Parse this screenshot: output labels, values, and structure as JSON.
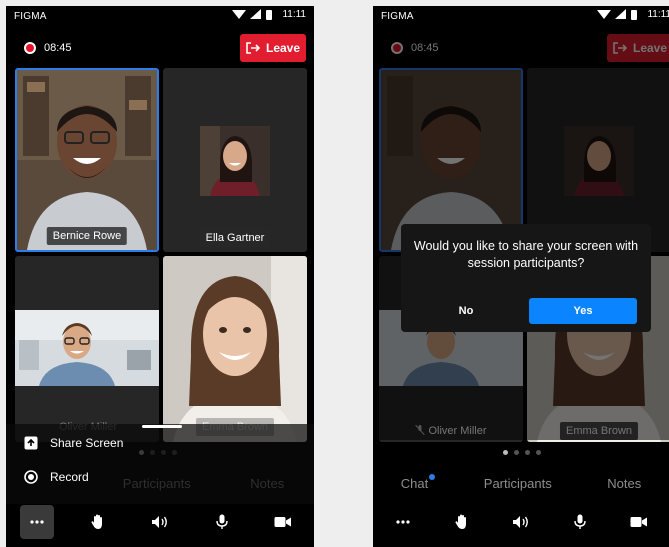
{
  "status_bar": {
    "carrier": "FIGMA",
    "time": "11:11"
  },
  "recording": {
    "timer": "08:45"
  },
  "header": {
    "leave_label": "Leave"
  },
  "participants": [
    {
      "name": "Bernice Rowe",
      "active": true
    },
    {
      "name": "Ella Gartner",
      "active": false
    },
    {
      "name": "Oliver Miller",
      "active": false
    },
    {
      "name": "Emma Brown",
      "active": false
    }
  ],
  "pager": {
    "current": 1,
    "total": 4
  },
  "tabs": [
    {
      "label": "Chat"
    },
    {
      "label": "Participants"
    },
    {
      "label": "Notes"
    }
  ],
  "toolbar": {
    "items": [
      {
        "icon": "more-icon"
      },
      {
        "icon": "raise-hand-icon"
      },
      {
        "icon": "speaker-icon"
      },
      {
        "icon": "microphone-icon"
      },
      {
        "icon": "video-camera-icon"
      }
    ]
  },
  "sheet": {
    "share_label": "Share Screen",
    "record_label": "Record"
  },
  "dialog": {
    "message": "Would you like to share your screen with session participants?",
    "no_label": "No",
    "yes_label": "Yes"
  },
  "colors": {
    "accent": "#2b7de9",
    "danger": "#e11d2f",
    "primary_button": "#0a84ff"
  }
}
